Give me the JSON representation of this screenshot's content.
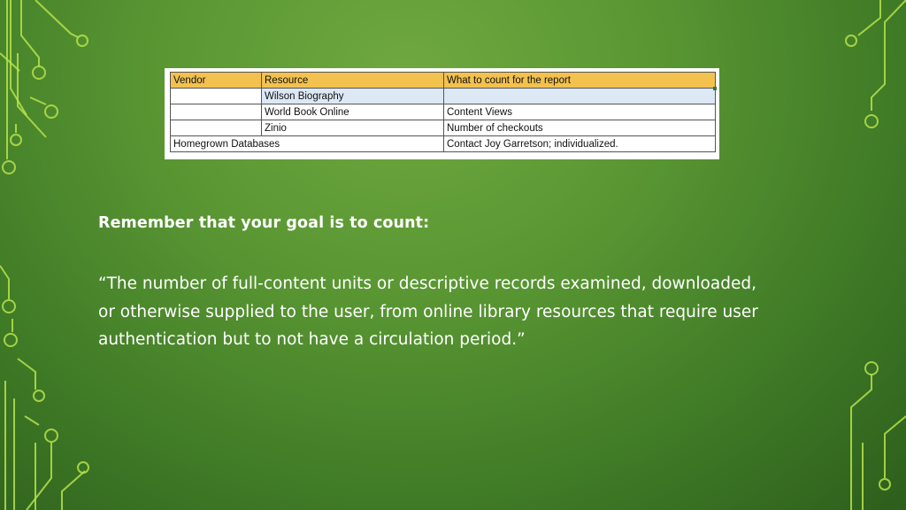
{
  "table": {
    "headers": [
      "Vendor",
      "Resource",
      "What to count for the report"
    ],
    "rows": [
      [
        "",
        "Wilson Biography",
        ""
      ],
      [
        "",
        "World Book Online",
        "Content Views"
      ],
      [
        "",
        "Zinio",
        "Number of checkouts"
      ],
      [
        "Homegrown Databases",
        "",
        "Contact Joy Garretson; individualized."
      ]
    ],
    "colors": {
      "header_fill": "#f2c14e",
      "highlight_fill": "#dde8f5"
    }
  },
  "heading": "Remember that your goal is to count:",
  "quote": "“The number of full-content units or descriptive records examined, downloaded, or otherwise supplied to the user, from online library resources that require user authentication but to not have a circulation period.”",
  "colors": {
    "background": "#5a9733",
    "circuit_lines": "#b6e34a",
    "text": "#ffffff"
  }
}
